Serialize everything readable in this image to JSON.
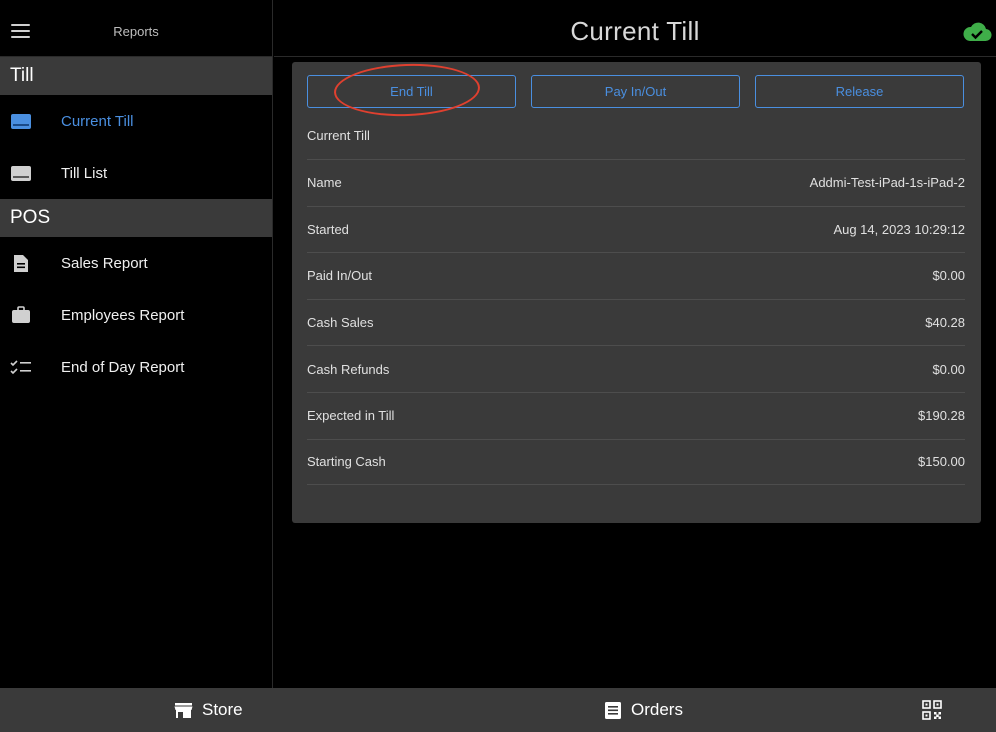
{
  "sidebar": {
    "title": "Reports",
    "sections": [
      {
        "label": "Till",
        "items": [
          {
            "label": "Current Till",
            "icon": "credit-card-icon",
            "active": true
          },
          {
            "label": "Till List",
            "icon": "keyboard-icon"
          }
        ]
      },
      {
        "label": "POS",
        "items": [
          {
            "label": "Sales Report",
            "icon": "document-icon"
          },
          {
            "label": "Employees Report",
            "icon": "briefcase-icon"
          },
          {
            "label": "End of Day Report",
            "icon": "checklist-icon"
          }
        ]
      }
    ]
  },
  "header": {
    "title": "Current Till",
    "sync_icon": "cloud-check-icon"
  },
  "card": {
    "buttons": {
      "end_till": "End Till",
      "pay_in_out": "Pay In/Out",
      "release": "Release"
    },
    "label": "Current Till",
    "rows": [
      {
        "label": "Name",
        "value": "Addmi-Test-iPad-1s-iPad-2"
      },
      {
        "label": "Started",
        "value": "Aug 14, 2023 10:29:12"
      },
      {
        "label": "Paid In/Out",
        "value": "$0.00"
      },
      {
        "label": "Cash Sales",
        "value": "$40.28"
      },
      {
        "label": "Cash Refunds",
        "value": "$0.00"
      },
      {
        "label": "Expected in Till",
        "value": "$190.28"
      },
      {
        "label": "Starting Cash",
        "value": "$150.00"
      }
    ]
  },
  "bottom_bar": {
    "store": "Store",
    "orders": "Orders",
    "qr_icon": "qr-code-icon"
  },
  "colors": {
    "accent": "#4a8fe0",
    "annotation": "#e0402f",
    "cloud": "#3fae49"
  }
}
